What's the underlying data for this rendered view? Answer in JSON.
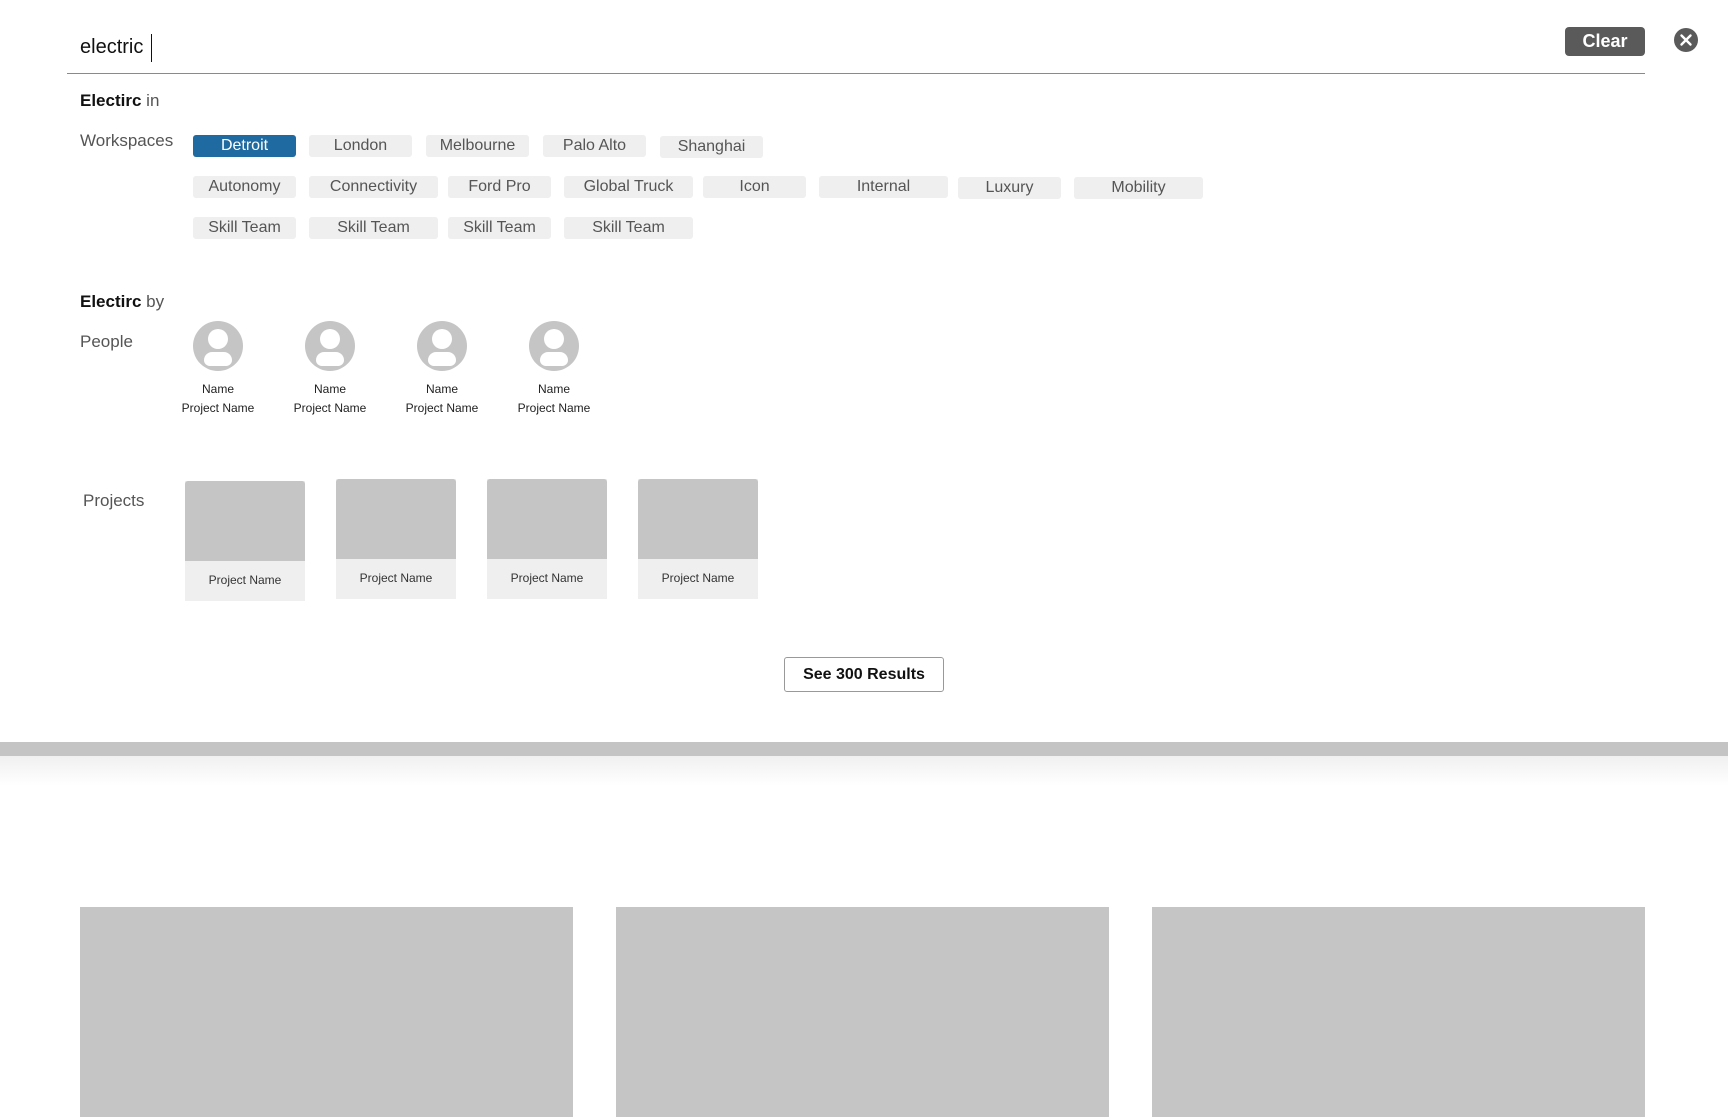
{
  "search": {
    "value": "electric",
    "clear_label": "Clear"
  },
  "workspaces_section": {
    "heading_bold": "Electirc",
    "heading_rest": "in",
    "row_label": "Workspaces",
    "locations": [
      "Detroit",
      "London",
      "Melbourne",
      "Palo Alto",
      "Shanghai"
    ],
    "selected": "Detroit",
    "categories": [
      "Autonomy",
      "Connectivity",
      "Ford Pro",
      "Global Truck",
      "Icon",
      "Internal",
      "Luxury",
      "Mobility"
    ],
    "teams": [
      "Skill Team",
      "Skill Team",
      "Skill Team",
      "Skill Team"
    ]
  },
  "people_section": {
    "heading_bold": "Electirc",
    "heading_rest": "by",
    "row_label": "People",
    "people": [
      {
        "name": "Name",
        "project": "Project Name"
      },
      {
        "name": "Name",
        "project": "Project Name"
      },
      {
        "name": "Name",
        "project": "Project Name"
      },
      {
        "name": "Name",
        "project": "Project Name"
      }
    ]
  },
  "projects_section": {
    "row_label": "Projects",
    "projects": [
      {
        "name": "Project Name"
      },
      {
        "name": "Project Name"
      },
      {
        "name": "Project Name"
      },
      {
        "name": "Project Name"
      }
    ]
  },
  "see_results_label": "See 300 Results",
  "colors": {
    "accent": "#1f6aa0",
    "chip_bg": "#efefef",
    "placeholder": "#c5c5c5",
    "clear_bg": "#5a5a5a"
  }
}
